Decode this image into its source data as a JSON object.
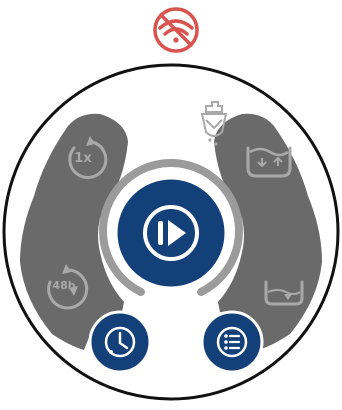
{
  "status": {
    "connectivity": {
      "icon": "wifi-off-icon",
      "color": "#d9534f",
      "state": "disconnected"
    }
  },
  "controls": {
    "play": {
      "icon": "play-pause-icon",
      "color": "#14407a"
    },
    "schedule": {
      "icon": "clock-icon",
      "color": "#14407a"
    },
    "menu": {
      "icon": "list-menu-icon",
      "color": "#14407a"
    },
    "once": {
      "icon": "repeat-once-icon",
      "label": "1x"
    },
    "every48h": {
      "icon": "repeat-48h-icon",
      "label": "48h"
    },
    "add_fertilizer": {
      "icon": "fertilizer-icon"
    },
    "water_level_full": {
      "icon": "tank-full-icon"
    },
    "water_level_low": {
      "icon": "tank-low-icon"
    }
  },
  "colors": {
    "panel": "#6a6a6a",
    "ring_inner": "#9b9b9b",
    "icon_light": "#a9a9a9",
    "outline": "#111111",
    "white": "#ffffff"
  }
}
